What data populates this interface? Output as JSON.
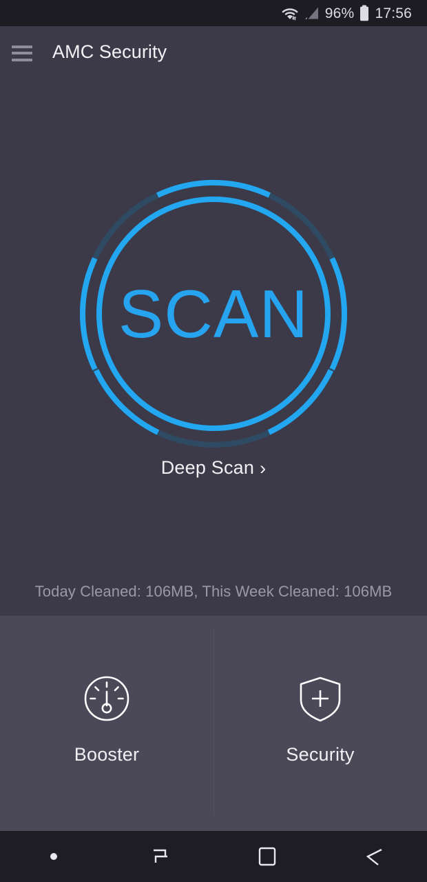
{
  "status_bar": {
    "wifi_icon": "wifi-icon",
    "signal_icon": "cellular-signal-icon",
    "battery_percent": "96%",
    "battery_icon": "battery-icon",
    "time": "17:56"
  },
  "app_bar": {
    "menu_icon": "hamburger-menu-icon",
    "title": "AMC Security"
  },
  "main": {
    "scan_button_label": "SCAN",
    "deep_scan_label": "Deep Scan",
    "deep_scan_chevron": "›",
    "cleaned_status": "Today Cleaned: 106MB, This Week Cleaned: 106MB"
  },
  "tiles": [
    {
      "label": "Booster",
      "icon": "speedometer-icon"
    },
    {
      "label": "Security",
      "icon": "shield-plus-icon"
    }
  ],
  "nav_bar": [
    {
      "name": "nav-indicator-dot",
      "icon": "dot-icon"
    },
    {
      "name": "nav-recents",
      "icon": "recents-icon"
    },
    {
      "name": "nav-home",
      "icon": "home-square-icon"
    },
    {
      "name": "nav-back",
      "icon": "back-arrow-icon"
    }
  ],
  "colors": {
    "accent_blue": "#26a4ef",
    "ring_dark_blue": "#2f4a63",
    "screen_bg": "#3c3a49",
    "panel_bg": "#4b4958",
    "status_bar_bg": "#1d1c23",
    "nav_bar_bg": "#1e1d24",
    "muted_text": "#9b99a6"
  }
}
